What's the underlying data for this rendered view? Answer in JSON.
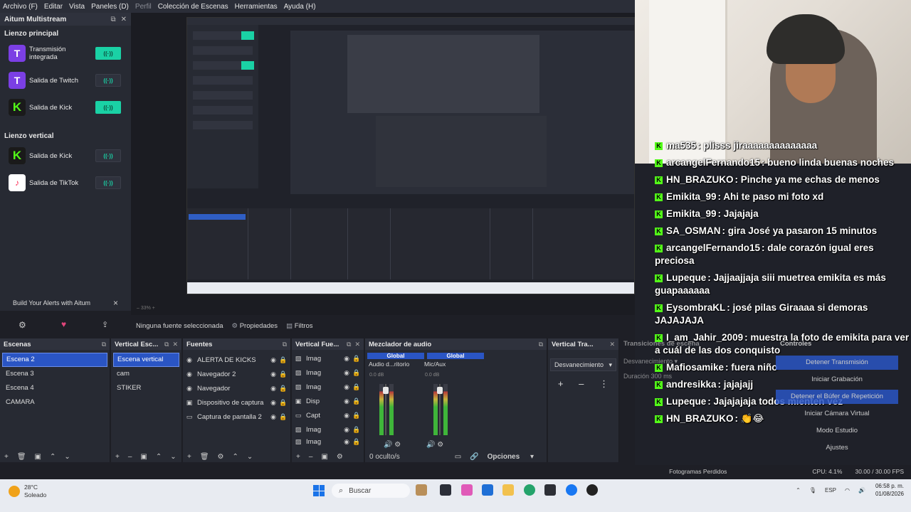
{
  "menu": [
    "Archivo (F)",
    "Editar",
    "Vista",
    "Paneles (D)",
    "Perfil",
    "Colección de Escenas",
    "Herramientas",
    "Ayuda (H)"
  ],
  "multistream": {
    "title": "Aitum Multistream",
    "main_canvas_label": "Lienzo principal",
    "main_outputs": [
      {
        "platform": "twitch",
        "glyph": "T",
        "label": "Transmisión integrada",
        "active": true
      },
      {
        "platform": "twitch",
        "glyph": "T",
        "label": "Salida de Twitch",
        "active": false
      },
      {
        "platform": "kick",
        "glyph": "K",
        "label": "Salida de Kick",
        "active": true
      }
    ],
    "vertical_canvas_label": "Lienzo vertical",
    "vertical_outputs": [
      {
        "platform": "kick",
        "glyph": "K",
        "label": "Salida de Kick",
        "active": false
      },
      {
        "platform": "tiktok",
        "glyph": "♪",
        "label": "Salida de TikTok",
        "active": false
      }
    ],
    "toggle_glyph": "((·))"
  },
  "alerts_bar": {
    "label": "Build Your Alerts with Aitum",
    "close": "×"
  },
  "source_toolbar": {
    "no_source": "Ninguna fuente seleccionada",
    "properties": "Propiedades",
    "filters": "Filtros"
  },
  "scenes": {
    "title": "Escenas",
    "items": [
      "Escena 2",
      "Escena 3",
      "Escena 4",
      "CAMARA"
    ],
    "selected": 0
  },
  "vertical_scenes": {
    "title": "Vertical Esc...",
    "items": [
      "Escena vertical",
      "cam",
      "STIKER"
    ],
    "selected": 0
  },
  "sources": {
    "title": "Fuentes",
    "items": [
      {
        "icon": "globe",
        "glyph": "◉",
        "label": "ALERTA DE KICKS"
      },
      {
        "icon": "globe",
        "glyph": "◉",
        "label": "Navegador 2"
      },
      {
        "icon": "globe",
        "glyph": "◉",
        "label": "Navegador"
      },
      {
        "icon": "device",
        "glyph": "▣",
        "label": "Dispositivo de captura"
      },
      {
        "icon": "monitor",
        "glyph": "▭",
        "label": "Captura de pantalla 2"
      }
    ]
  },
  "vertical_sources": {
    "title": "Vertical Fue...",
    "items": [
      "Imag",
      "Imag",
      "Imag",
      "Disp",
      "Capt",
      "Imag",
      "Imag"
    ]
  },
  "mixer": {
    "title": "Mezclador de audio",
    "tabs": [
      "Global",
      "Global"
    ],
    "channels": [
      "Audio d...ritorio",
      "Mic/Aux"
    ],
    "db_top": "0.0 dB",
    "hidden_count": "0 oculto/s",
    "options": "Opciones"
  },
  "vertical_transitions": {
    "title": "Vertical Tra...",
    "value": "Desvanecimiento"
  },
  "transitions": {
    "title": "Transiciones de escena",
    "value": "Desvanecimiento",
    "duration_label": "Duración",
    "duration_value": "300 ms"
  },
  "controls": {
    "title": "Controles",
    "buttons": [
      "Detener Transmisión",
      "Iniciar Grabación",
      "Detener el Búfer de Repetición",
      "Iniciar Cámara Virtual",
      "Modo Estudio",
      "Ajustes"
    ],
    "active_index": [
      0,
      2
    ]
  },
  "chat": [
    {
      "user": "ma535",
      "text": ": plisss jiraaaaaaaaaaaaaa"
    },
    {
      "user": "arcangelFernando15",
      "text": ": bueno linda buenas noches"
    },
    {
      "user": "HN_BRAZUKO",
      "text": ": Pinche ya me echas de menos"
    },
    {
      "user": "Emikita_99",
      "text": ": Ahi te paso mi foto xd"
    },
    {
      "user": "Emikita_99",
      "text": ": Jajajaja"
    },
    {
      "user": "SA_OSMAN",
      "text": ": gira José ya pasaron 15 minutos"
    },
    {
      "user": "arcangelFernando15",
      "text": ": dale corazón igual eres preciosa"
    },
    {
      "user": "Lupeque",
      "text": ": Jajjaajjaja siii muetrea emikita es más guapaaaaaa"
    },
    {
      "user": "EysombraKL",
      "text": ": josé pilas Giraaaa si demoras JAJAJAJA"
    },
    {
      "user": "I_am_Jahir_2009",
      "text": ": muestra la foto de emikita para ver a cuál de las dos conquisto"
    },
    {
      "user": "Mafiosamike",
      "text": ": fuera niño"
    },
    {
      "user": "andresikka",
      "text": ": jajajajj"
    },
    {
      "user": "Lupeque",
      "text": ": Jajajajaja todos mienten vez"
    },
    {
      "user": "HN_BRAZUKO",
      "text": ": 👏😂"
    }
  ],
  "status": {
    "dropped_frames": "Fotogramas Perdidos",
    "cpu": "CPU: 4.1%",
    "fps": "30.00 / 30.00 FPS"
  },
  "taskbar": {
    "temp": "28°C",
    "weather": "Soleado",
    "search": "Buscar",
    "lang": "ESP",
    "time": "06:58 p. m.",
    "date": "01/08/2026"
  },
  "colors": {
    "accent": "#1ad1a5",
    "selection": "#2a55c4",
    "kick": "#53fc18",
    "twitch": "#7b3fe4"
  }
}
